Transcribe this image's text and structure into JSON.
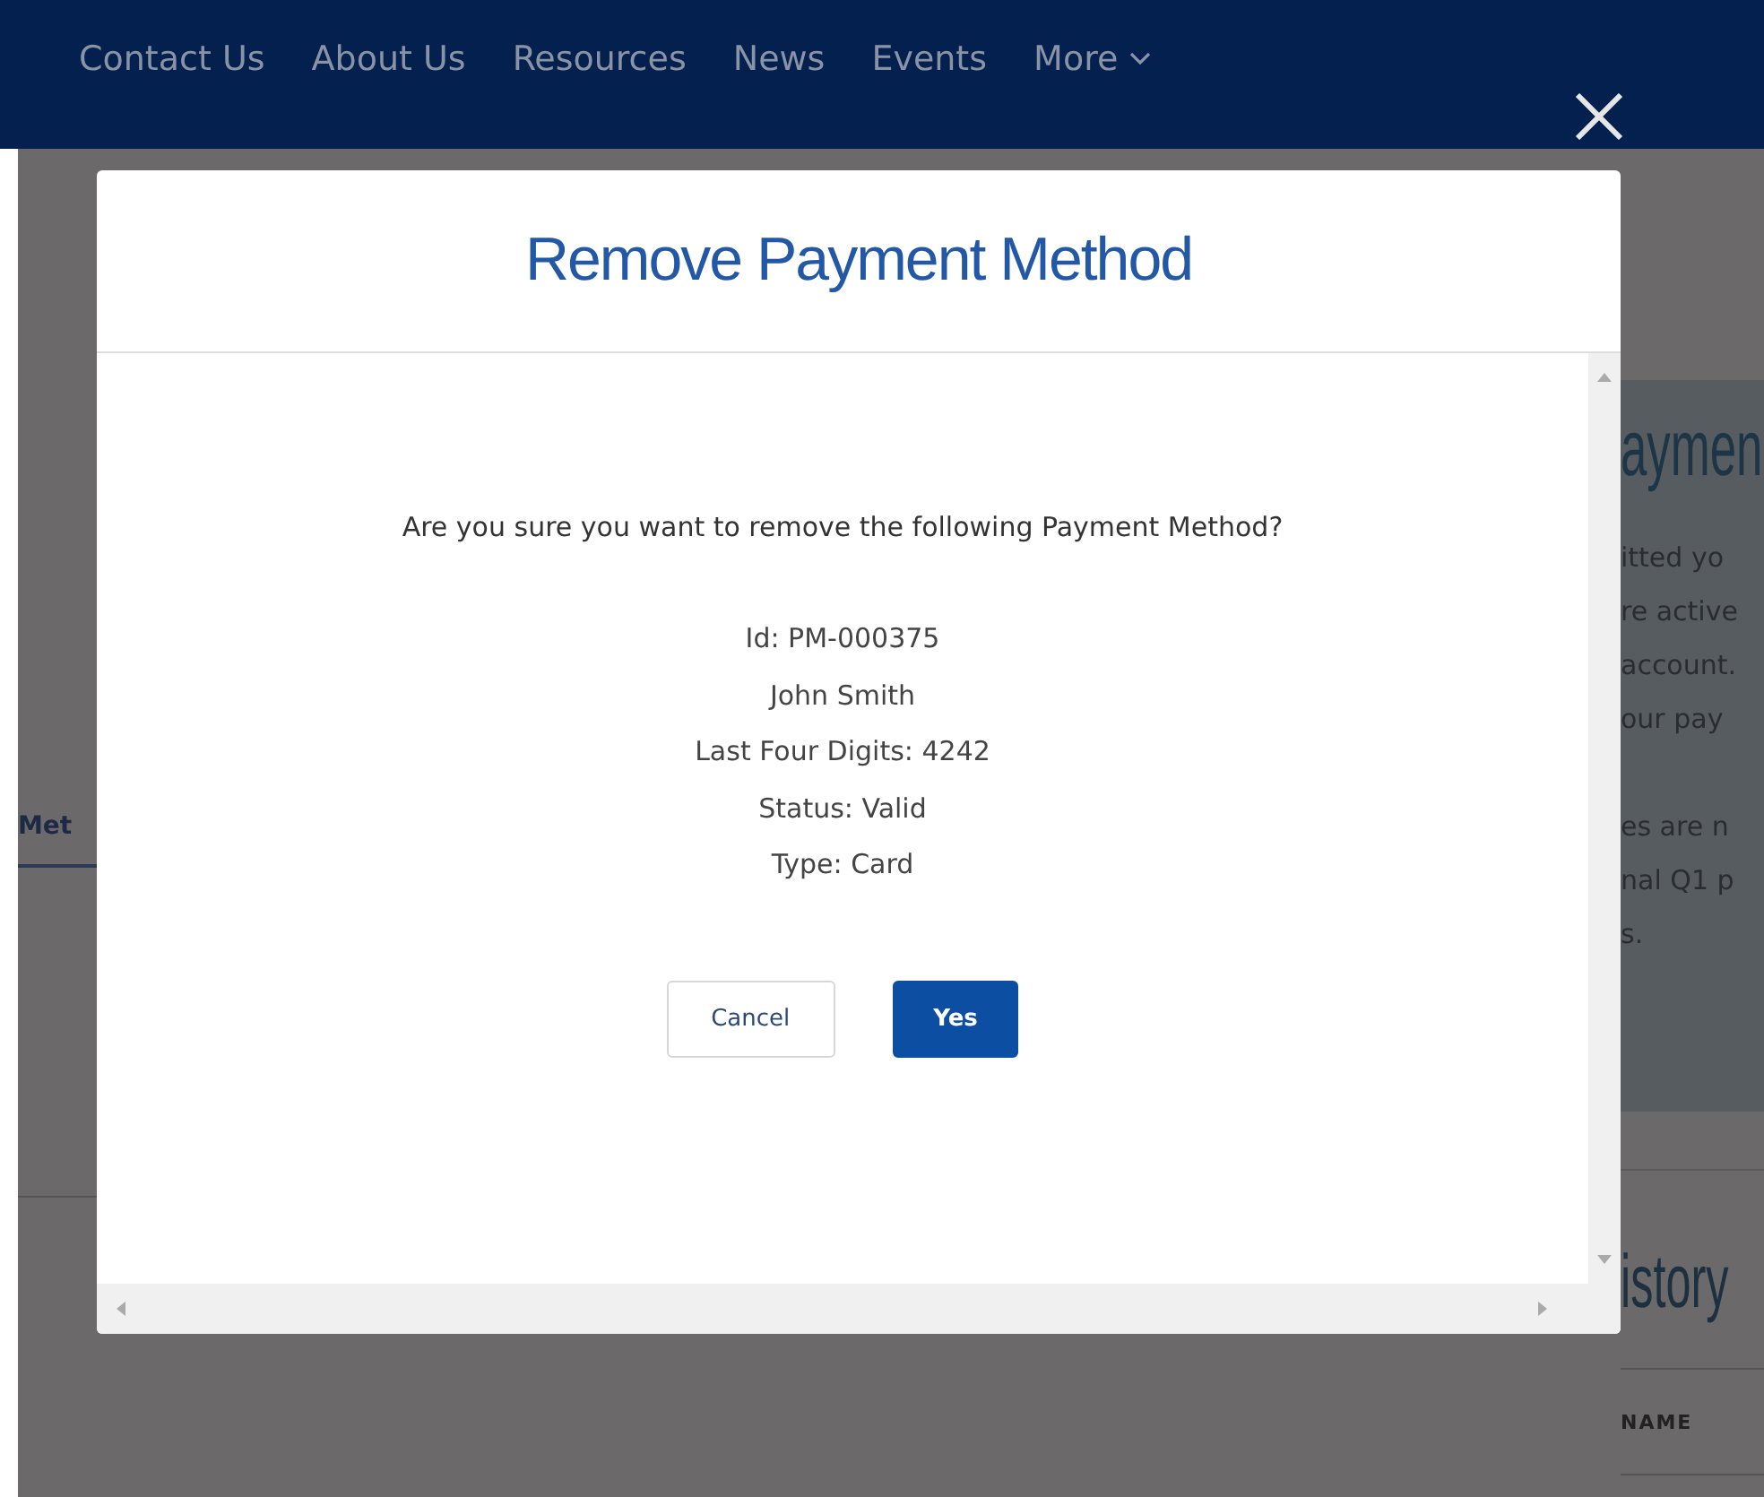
{
  "nav": {
    "items": [
      "Contact Us",
      "About Us",
      "Resources",
      "News",
      "Events",
      "More"
    ]
  },
  "background": {
    "tab": "Met",
    "panel": {
      "heading": "aymen",
      "paragraphs": [
        [
          "itted yo",
          "re active",
          "account.",
          "our pay"
        ],
        [
          "es are n",
          "nal Q1 p",
          "s."
        ]
      ]
    },
    "section_heading": "istory",
    "table_header": "NAME"
  },
  "modal": {
    "title": "Remove Payment Method",
    "question": "Are you sure you want to remove the following Payment Method?",
    "details": [
      "Id: PM-000375",
      "John Smith",
      "Last Four Digits: 4242",
      "Status: Valid",
      "Type: Card"
    ],
    "buttons": [
      {
        "label": "Cancel",
        "kind": "secondary"
      },
      {
        "label": "Yes",
        "kind": "primary"
      }
    ]
  }
}
